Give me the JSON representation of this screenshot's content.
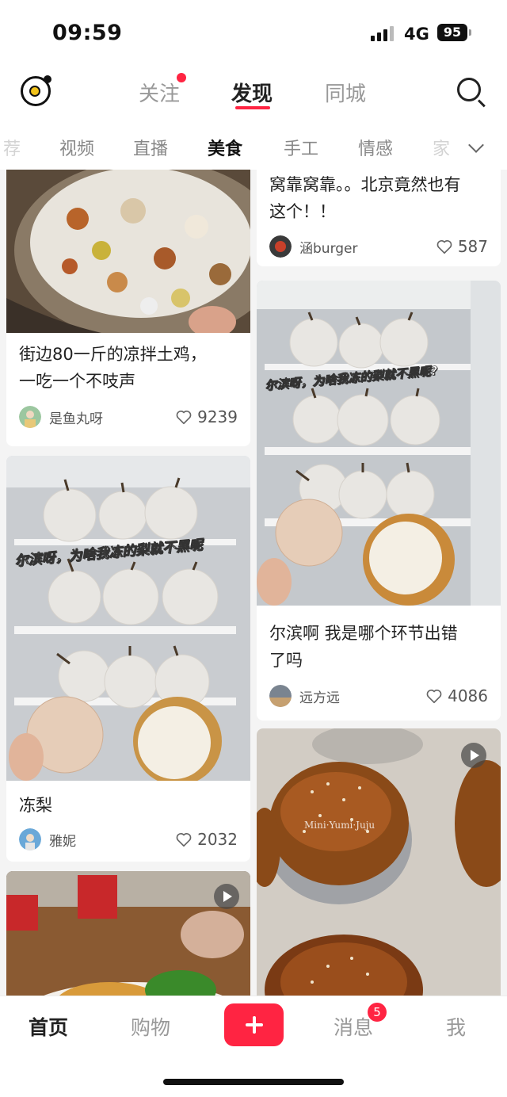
{
  "status": {
    "time": "09:59",
    "network": "4G",
    "battery": "95"
  },
  "top_tabs": {
    "follow": "关注",
    "discover": "发现",
    "city": "同城"
  },
  "categories": [
    "荐",
    "视频",
    "直播",
    "美食",
    "手工",
    "情感",
    "家"
  ],
  "active_category": "美食",
  "feed": {
    "cards": [
      {
        "title_line1": "街边80一斤的凉拌土鸡，",
        "title_line2": "一吃一个不吱声",
        "author": "是鱼丸呀",
        "likes": "9239"
      },
      {
        "title_line1": "窝靠窝靠。。北京竟然也有",
        "title_line2": "这个！！",
        "author": "涵burger",
        "likes": "587"
      },
      {
        "title_line1": "冻梨",
        "author": "雅妮",
        "likes": "2032",
        "overlay": "尔滨呀，为啥我冻的梨就不黑呢"
      },
      {
        "title_line1": "尔滨啊 我是哪个环节出错",
        "title_line2": "了吗",
        "author": "远方远",
        "likes": "4086",
        "overlay": "尔滨呀，为啥我冻的梨就不黑呢?"
      },
      {
        "watermark": "Mini·Yumi·Juju"
      }
    ]
  },
  "bottom_nav": {
    "home": "首页",
    "shop": "购物",
    "messages": "消息",
    "messages_badge": "5",
    "me": "我"
  },
  "colors": {
    "accent": "#ff2442"
  }
}
